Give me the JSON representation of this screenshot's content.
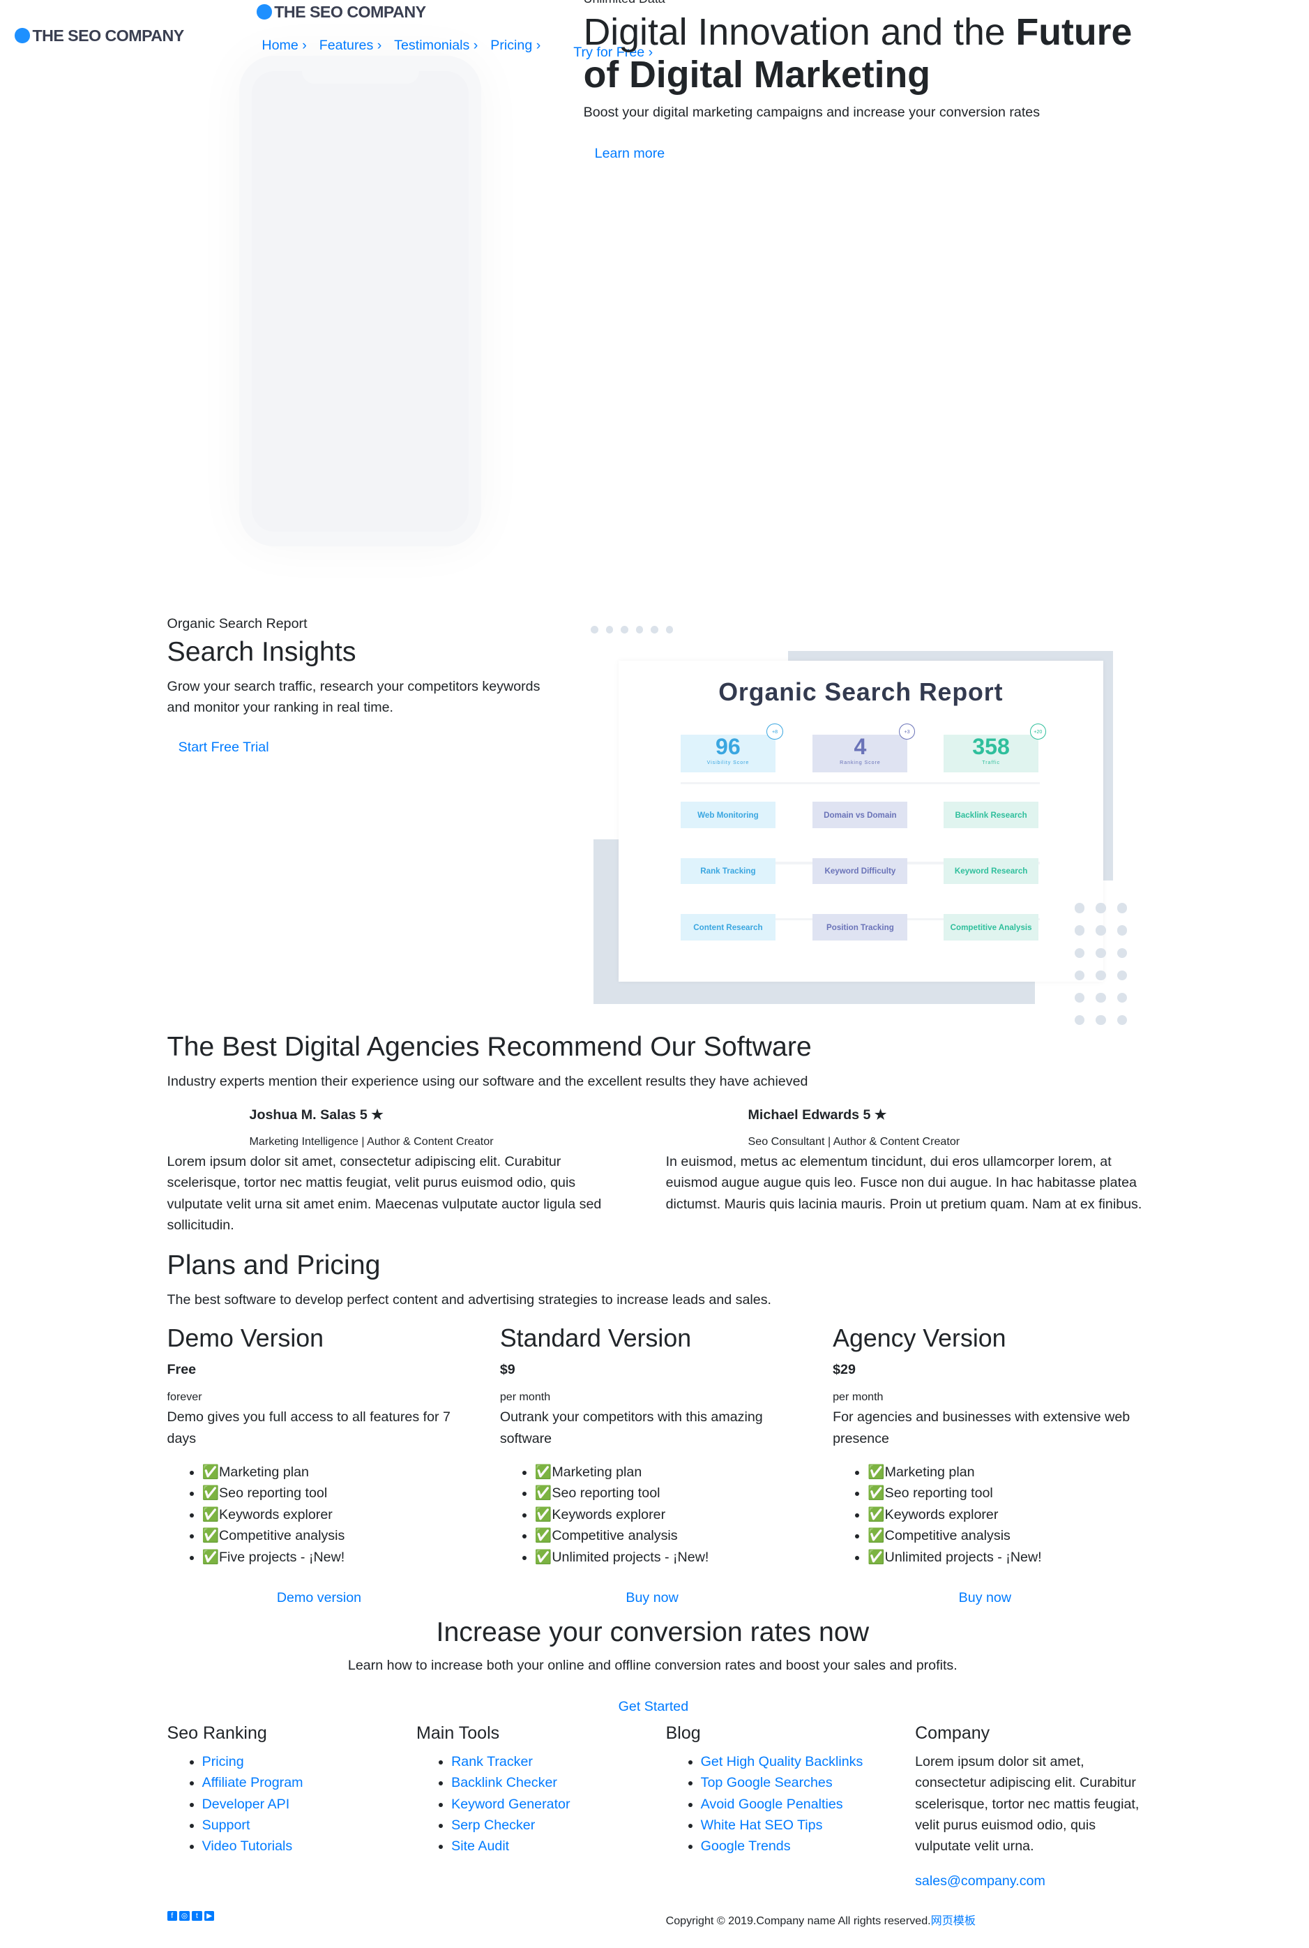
{
  "brand": {
    "name": "THE SEO COMPANY",
    "accent": "#007bff",
    "logo_dot": "#1e90ff"
  },
  "nav": {
    "items": [
      {
        "label": "Home ›"
      },
      {
        "label": "Features ›"
      },
      {
        "label": "Testimonials ›"
      },
      {
        "label": "Pricing ›"
      }
    ],
    "cta": "Try for Free ›"
  },
  "hero": {
    "eyebrow": "Unlimited Data",
    "title_regular": "Digital Innovation and the ",
    "title_bold_1": "Future",
    "title_bold_2": "of Digital Marketing",
    "subtitle": "Boost your digital marketing campaigns and increase your conversion rates",
    "button": "Learn more"
  },
  "insights": {
    "eyebrow": "Organic Search Report",
    "title": "Search Insights",
    "text": "Grow your search traffic, research your competitors keywords and monitor your ranking in real time.",
    "button": "Start Free Trial",
    "report": {
      "title": "Organic Search Report",
      "stats": [
        {
          "value": "96",
          "label": "Visibility Score",
          "badge": "+8",
          "color": "#3aa6e0"
        },
        {
          "value": "4",
          "label": "Ranking Score",
          "badge": "+3",
          "color": "#6a73b8"
        },
        {
          "value": "358",
          "label": "Traffic",
          "badge": "+20",
          "color": "#2fbf9c"
        }
      ],
      "tools": [
        [
          "Web Monitoring",
          "Domain vs Domain",
          "Backlink Research"
        ],
        [
          "Rank Tracking",
          "Keyword Difficulty",
          "Keyword Research"
        ],
        [
          "Content Research",
          "Position Tracking",
          "Competitive Analysis"
        ]
      ]
    }
  },
  "testimonials": {
    "title": "The Best Digital Agencies Recommend Our Software",
    "subtitle": "Industry experts mention their experience using our software and the excellent results they have achieved",
    "items": [
      {
        "name": "Joshua M. Salas 5 ★",
        "role": "Marketing Intelligence | Author & Content Creator",
        "text": "Lorem ipsum dolor sit amet, consectetur adipiscing elit. Curabitur scelerisque, tortor nec mattis feugiat, velit purus euismod odio, quis vulputate velit urna sit amet enim. Maecenas vulputate auctor ligula sed sollicitudin."
      },
      {
        "name": "Michael Edwards 5 ★",
        "role": "Seo Consultant | Author & Content Creator",
        "text": "In euismod, metus ac elementum tincidunt, dui eros ullamcorper lorem, at euismod augue augue quis leo. Fusce non dui augue. In hac habitasse platea dictumst. Mauris quis lacinia mauris. Proin ut pretium quam. Nam at ex finibus."
      }
    ]
  },
  "pricing": {
    "title": "Plans and Pricing",
    "subtitle": "The best software to develop perfect content and advertising strategies to increase leads and sales.",
    "plans": [
      {
        "name": "Demo Version",
        "price": "Free",
        "period": "forever",
        "desc": "Demo gives you full access to all features for 7 days",
        "features": [
          "✅Marketing plan",
          "✅Seo reporting tool",
          "✅Keywords explorer",
          "✅Competitive analysis",
          "✅Five projects - ¡New!"
        ],
        "button": "Demo version"
      },
      {
        "name": "Standard Version",
        "price": "$9",
        "period": "per month",
        "desc": "Outrank your competitors with this amazing software",
        "features": [
          "✅Marketing plan",
          "✅Seo reporting tool",
          "✅Keywords explorer",
          "✅Competitive analysis",
          "✅Unlimited projects - ¡New!"
        ],
        "button": "Buy now"
      },
      {
        "name": "Agency Version",
        "price": "$29",
        "period": "per month",
        "desc": "For agencies and businesses with extensive web presence",
        "features": [
          "✅Marketing plan",
          "✅Seo reporting tool",
          "✅Keywords explorer",
          "✅Competitive analysis",
          "✅Unlimited projects - ¡New!"
        ],
        "button": "Buy now"
      }
    ]
  },
  "cta": {
    "title": "Increase your conversion rates now",
    "text": "Learn how to increase both your online and offline conversion rates and boost your sales and profits.",
    "button": "Get Started"
  },
  "footer": {
    "columns": [
      {
        "title": "Seo Ranking",
        "links": [
          "Pricing",
          "Affiliate Program",
          "Developer API",
          "Support",
          "Video Tutorials"
        ]
      },
      {
        "title": "Main Tools",
        "links": [
          "Rank Tracker",
          "Backlink Checker",
          "Keyword Generator",
          "Serp Checker",
          "Site Audit"
        ]
      },
      {
        "title": "Blog",
        "links": [
          "Get High Quality Backlinks",
          "Top Google Searches",
          "Avoid Google Penalties",
          "White Hat SEO Tips",
          "Google Trends"
        ]
      }
    ],
    "company": {
      "title": "Company",
      "text": "Lorem ipsum dolor sit amet, consectetur adipiscing elit. Curabitur scelerisque, tortor nec mattis feugiat, velit purus euismod odio, quis vulputate velit urna.",
      "email": "sales@company.com"
    },
    "social": [
      "facebook-icon",
      "instagram-icon",
      "twitter-icon",
      "youtube-icon"
    ],
    "copyright": "Copyright © 2019.Company name All rights reserved.",
    "copyright_link": "网页模板"
  }
}
